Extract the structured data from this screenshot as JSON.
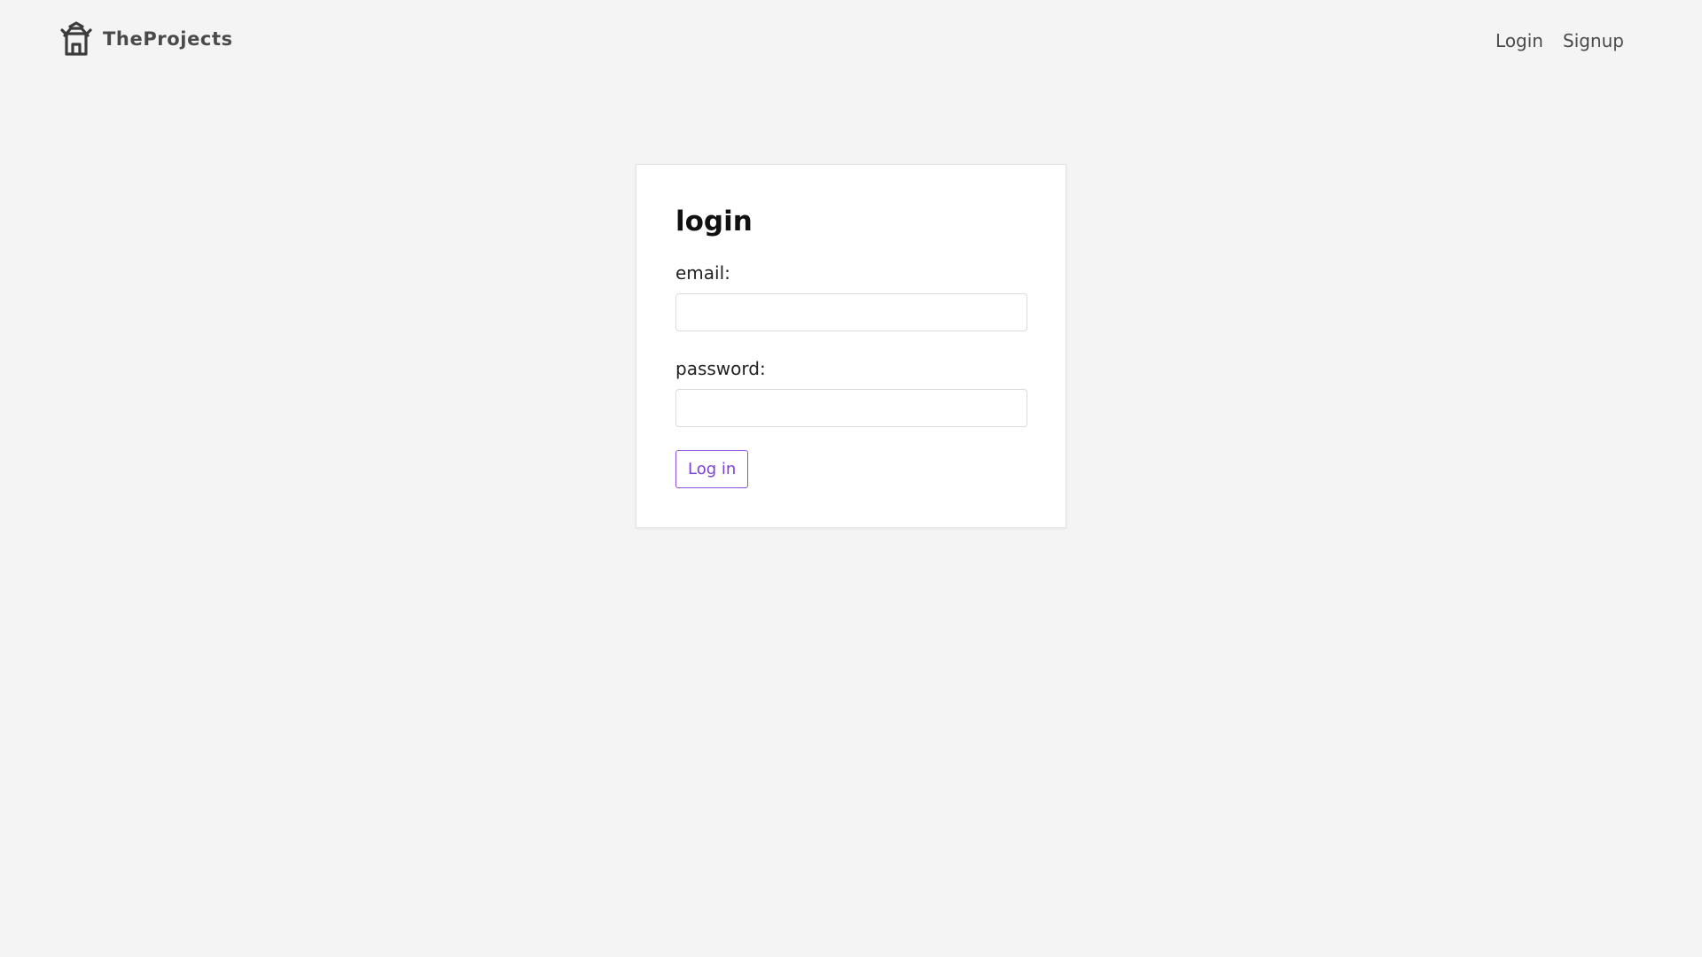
{
  "header": {
    "brand_name": "TheProjects",
    "brand_icon": "shrine-icon",
    "nav": {
      "login_label": "Login",
      "signup_label": "Signup"
    }
  },
  "login_form": {
    "title": "login",
    "email": {
      "label": "email:",
      "value": "",
      "placeholder": ""
    },
    "password": {
      "label": "password:",
      "value": "",
      "placeholder": ""
    },
    "submit_label": "Log in"
  },
  "colors": {
    "background": "#f4f4f4",
    "accent": "#7a40d8",
    "text": "#4a4a4a"
  }
}
